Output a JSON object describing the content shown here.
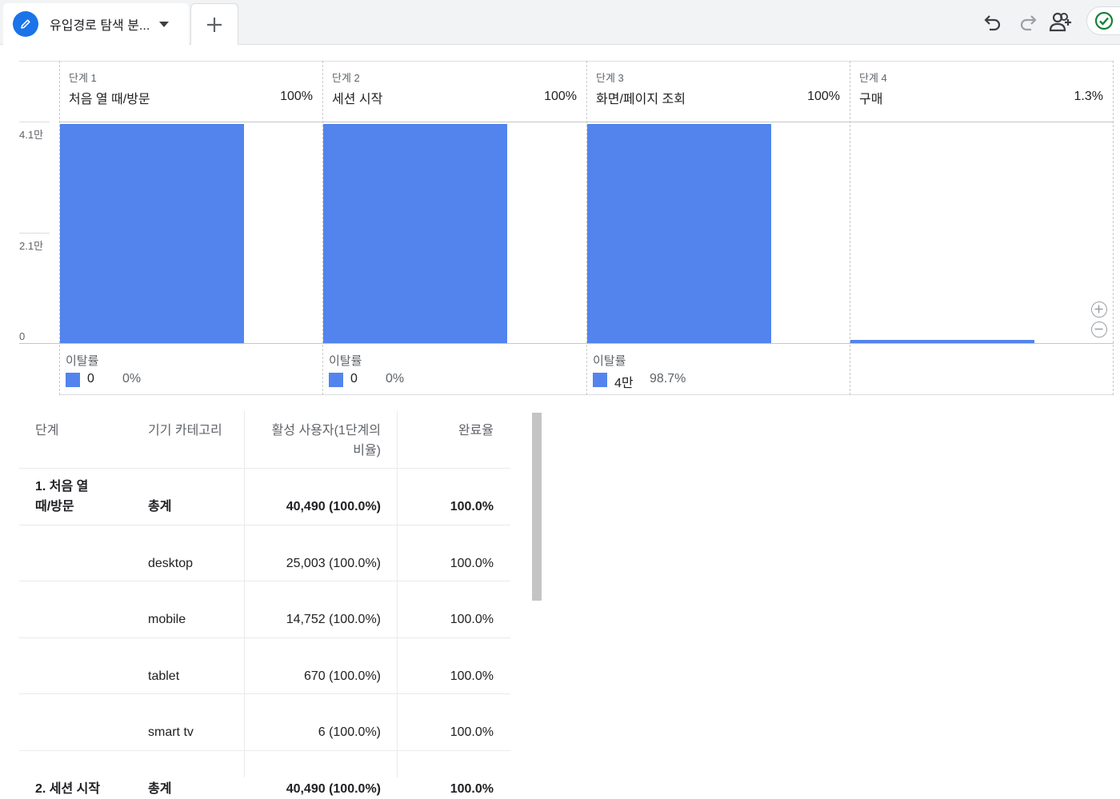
{
  "tab": {
    "title": "유입경로 탐색 분...",
    "icon": "pencil-icon"
  },
  "toolbar": {
    "undo_icon": "undo-icon",
    "redo_icon": "redo-icon",
    "share_icon": "add-person-icon",
    "status_icon": "check-circle-icon"
  },
  "colors": {
    "bar": "#5384ed",
    "accent": "#1a73e8",
    "check": "#188038"
  },
  "chart_data": {
    "type": "bar",
    "categories": [
      "처음 열 때/방문",
      "세션 시작",
      "화면/페이지 조회",
      "구매"
    ],
    "values": [
      40490,
      40490,
      40490,
      532
    ],
    "ylim": [
      0,
      41000
    ],
    "yticks": [
      "4.1만",
      "2.1만",
      "0"
    ],
    "grid": true
  },
  "steps": [
    {
      "num": "단계 1",
      "name": "처음 열 때/방문",
      "pct": "100%",
      "drop_label": "이탈률",
      "drop_count": "0",
      "drop_pct": "0%"
    },
    {
      "num": "단계 2",
      "name": "세션 시작",
      "pct": "100%",
      "drop_label": "이탈률",
      "drop_count": "0",
      "drop_pct": "0%"
    },
    {
      "num": "단계 3",
      "name": "화면/페이지 조회",
      "pct": "100%",
      "drop_label": "이탈률",
      "drop_count": "4만",
      "drop_pct": "98.7%"
    },
    {
      "num": "단계 4",
      "name": "구매",
      "pct": "1.3%"
    }
  ],
  "table": {
    "headers": {
      "step": "단계",
      "device": "기기 카테고리",
      "users_1": "활성 사용자(1단계의",
      "users_2": "비율)",
      "rate": "완료율"
    },
    "rows": [
      {
        "step_1": "1. 처음 열",
        "step_2": "때/방문",
        "device": "총계",
        "users": "40,490 (100.0%)",
        "rate": "100.0%",
        "bold": true
      },
      {
        "step_1": "",
        "step_2": "",
        "device": "desktop",
        "users": "25,003 (100.0%)",
        "rate": "100.0%",
        "bold": false
      },
      {
        "step_1": "",
        "step_2": "",
        "device": "mobile",
        "users": "14,752 (100.0%)",
        "rate": "100.0%",
        "bold": false
      },
      {
        "step_1": "",
        "step_2": "",
        "device": "tablet",
        "users": "670 (100.0%)",
        "rate": "100.0%",
        "bold": false
      },
      {
        "step_1": "",
        "step_2": "",
        "device": "smart tv",
        "users": "6 (100.0%)",
        "rate": "100.0%",
        "bold": false
      },
      {
        "step_1": "2. 세션 시작",
        "step_2": "",
        "device": "총계",
        "users": "40,490 (100.0%)",
        "rate": "100.0%",
        "bold": true
      }
    ]
  }
}
